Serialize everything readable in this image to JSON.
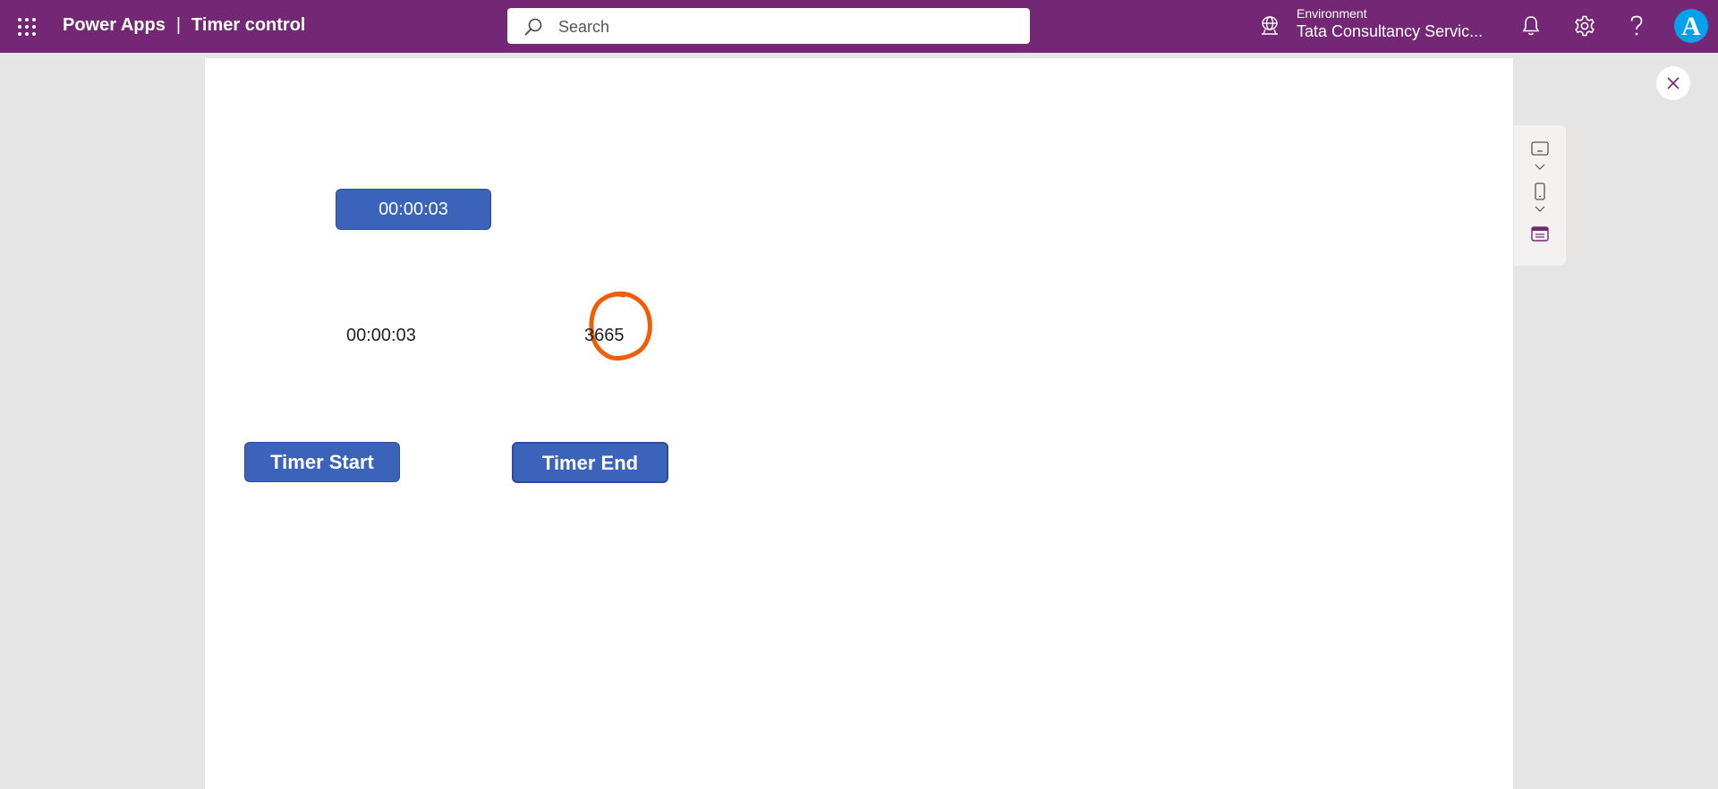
{
  "header": {
    "app_name": "Power Apps",
    "separator": "|",
    "app_title": "Timer control",
    "search_placeholder": "Search",
    "environment_label": "Environment",
    "environment_name": "Tata Consultancy Servic...",
    "avatar_initial": "A",
    "brand_color": "#742774",
    "avatar_color": "#00a2ed"
  },
  "canvas": {
    "timer_display": "00:00:03",
    "time_label": "00:00:03",
    "count_label": "3665",
    "start_button": "Timer Start",
    "end_button": "Timer End",
    "button_color": "#3b63ba",
    "annotation_color": "#f25c05"
  },
  "side_panel": {
    "icons": [
      "keyboard-icon",
      "chevron-down-icon",
      "phone-icon",
      "chevron-down-icon",
      "layout-icon"
    ]
  }
}
